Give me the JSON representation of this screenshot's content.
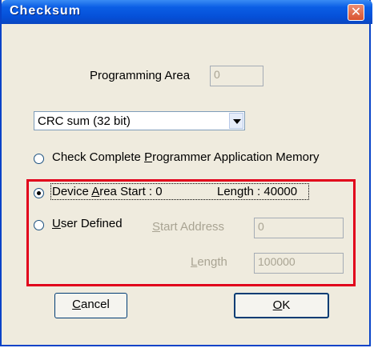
{
  "window": {
    "title": "Checksum"
  },
  "programming_area": {
    "label": "Programming Area",
    "value": "0"
  },
  "checksum_type": {
    "selected": "CRC sum (32 bit)"
  },
  "options": {
    "complete_memory": {
      "pre": "Check Complete ",
      "accel": "P",
      "post": "rogrammer Application Memory",
      "checked": false
    },
    "device_area": {
      "pre": "Device ",
      "accel": "A",
      "post": "rea Start : 0",
      "length_text": "Length : 40000",
      "checked": true
    },
    "user_defined": {
      "pre": "",
      "accel": "U",
      "post": "ser Defined",
      "checked": false
    }
  },
  "user_defined_fields": {
    "start_label_accel": "S",
    "start_label_rest": "tart Address",
    "start_value": "0",
    "length_label_accel": "L",
    "length_label_rest": "ength",
    "length_value": "100000"
  },
  "buttons": {
    "cancel": {
      "accel": "C",
      "rest": "ancel"
    },
    "ok": {
      "accel": "O",
      "rest": "K"
    }
  },
  "colors": {
    "title_bar": "#0550d8",
    "dialog_bg": "#efebde",
    "highlight": "#e1001b",
    "disabled_text": "#a9a493"
  }
}
